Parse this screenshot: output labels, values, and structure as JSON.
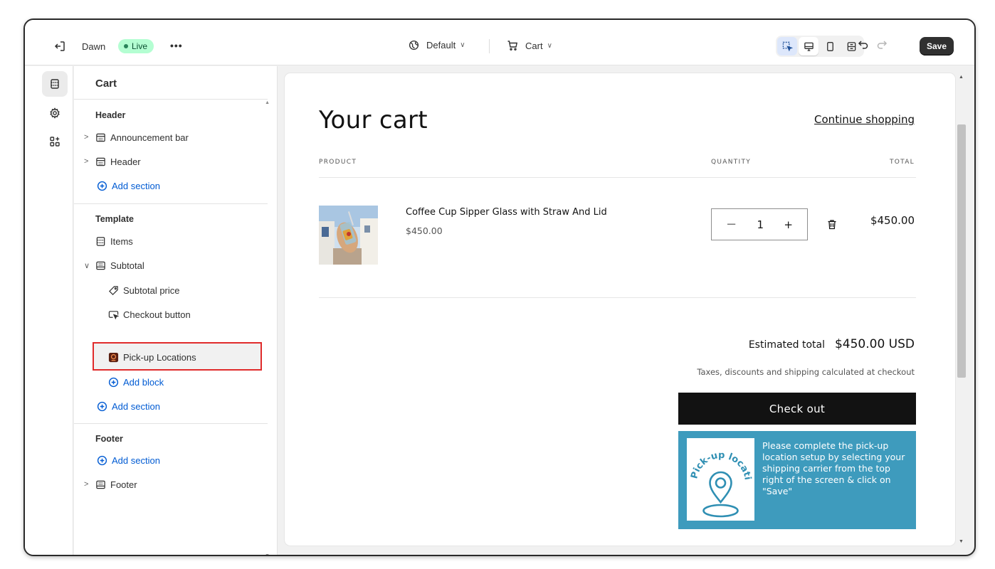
{
  "topbar": {
    "theme_name": "Dawn",
    "live_label": "Live",
    "more_label": "•••",
    "context_default": "Default",
    "context_page": "Cart",
    "save_label": "Save"
  },
  "sidebar": {
    "title": "Cart",
    "header_group": {
      "heading": "Header",
      "items": [
        "Announcement bar",
        "Header"
      ],
      "add_section": "Add section"
    },
    "template_group": {
      "heading": "Template",
      "items_label": "Items",
      "subtotal_label": "Subtotal",
      "blocks": [
        "Subtotal price",
        "Checkout button",
        "Pick-up Locations"
      ],
      "add_block": "Add block",
      "add_section": "Add section"
    },
    "footer_group": {
      "heading": "Footer",
      "add_section": "Add section",
      "footer_label": "Footer"
    }
  },
  "preview": {
    "title": "Your cart",
    "continue_label": "Continue shopping",
    "col_product": "PRODUCT",
    "col_quantity": "QUANTITY",
    "col_total": "TOTAL",
    "product": {
      "name": "Coffee Cup Sipper Glass with Straw And Lid",
      "price": "$450.00",
      "quantity": "1",
      "total": "$450.00"
    },
    "estimated_label": "Estimated total",
    "estimated_value": "$450.00 USD",
    "tax_note": "Taxes, discounts and shipping calculated at checkout",
    "checkout_label": "Check out",
    "pickup_message": "Please complete the pick-up location setup by selecting your shipping carrier from the top right of the screen & click on \"Save\"",
    "pickup_logo_text": "Pick-up location"
  },
  "colors": {
    "accent_blue": "#005bd3",
    "live_badge": "#b4fed2",
    "pickup_banner": "#3e9bbd",
    "highlight_red": "#e02b2b",
    "checkout_black": "#121212"
  },
  "icons": [
    "exit-icon",
    "globe-icon",
    "cart-icon",
    "inspector-icon",
    "desktop-icon",
    "mobile-icon",
    "fullscreen-icon",
    "undo-icon",
    "redo-icon",
    "sections-icon",
    "settings-icon",
    "apps-icon",
    "section-icon",
    "block-icon",
    "plus-circle-icon",
    "price-tag-icon",
    "cursor-button-icon",
    "app-block-icon",
    "trash-icon",
    "location-pin-icon"
  ]
}
